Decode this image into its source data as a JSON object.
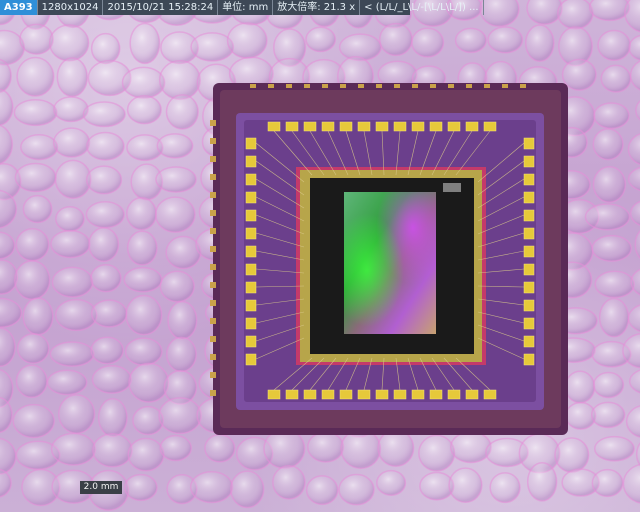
{
  "header": {
    "capture_id": "A393",
    "resolution": "1280x1024",
    "timestamp": "2015/10/21 15:28:24",
    "unit": "单位: mm",
    "magnification": "放大倍率: 21.3 x",
    "extra": "< (L/L/_L\\L/-[\\L/L\\L/]) ..."
  },
  "scale_bar": {
    "label": "2.0 mm"
  },
  "colors": {
    "header_bg": "#3d4856",
    "id_bg": "#2f8fd8",
    "package_outer": "#6d3a5d",
    "package_inner": "#7c4fa1",
    "gold": "#e6c93a",
    "die_bg": "#1a1a1a"
  }
}
